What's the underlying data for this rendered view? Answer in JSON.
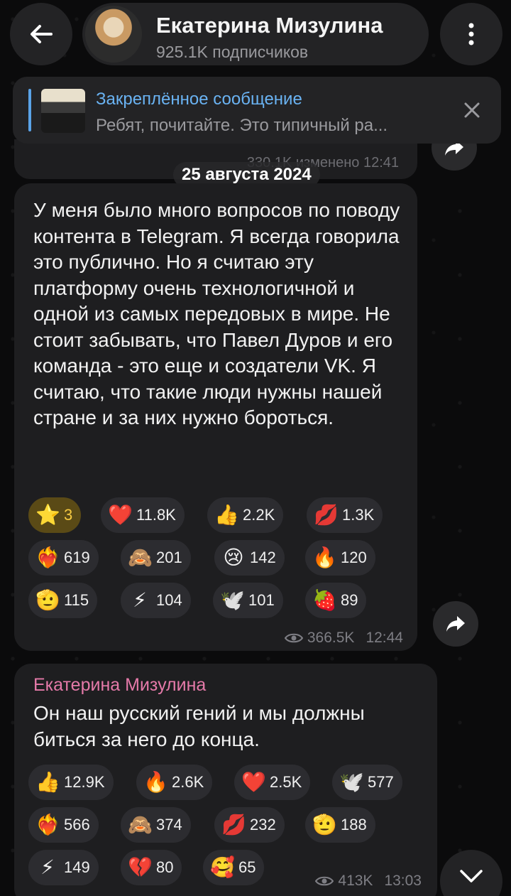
{
  "header": {
    "channel_name": "Екатерина Мизулина",
    "subscribers": "925.1K подписчиков"
  },
  "pinned": {
    "title": "Закреплённое сообщение",
    "text": "Ребят, почитайте. Это типичный ра..."
  },
  "previous_post": {
    "views": "330.1K",
    "edited_time": "изменено 12:41"
  },
  "date_separator": "25 августа 2024",
  "post1": {
    "text": "У меня было много вопросов по поводу контента в Telegram. Я всегда говорила это публично. Но я считаю эту платформу очень технологичной и одной из самых передовых в мире. Не стоит забывать, что Павел Дуров и его команда - это еще и создатели VK. Я считаю, что такие люди нужны нашей стране и за них нужно бороться.",
    "reactions": [
      {
        "emoji": "⭐",
        "count": "3"
      },
      {
        "emoji": "❤️",
        "count": "11.8K"
      },
      {
        "emoji": "👍",
        "count": "2.2K"
      },
      {
        "emoji": "💋",
        "count": "1.3K"
      },
      {
        "emoji": "❤️‍🔥",
        "count": "619"
      },
      {
        "emoji": "🙈",
        "count": "201"
      },
      {
        "emoji": "😢",
        "count": "142"
      },
      {
        "emoji": "🔥",
        "count": "120"
      },
      {
        "emoji": "🫡",
        "count": "115"
      },
      {
        "emoji": "⚡",
        "count": "104"
      },
      {
        "emoji": "🕊️",
        "count": "101"
      },
      {
        "emoji": "🍓",
        "count": "89"
      }
    ],
    "views": "366.5K",
    "time": "12:44"
  },
  "post2": {
    "sender": "Екатерина Мизулина",
    "text": "Он наш русский гений и мы должны биться за него до конца.",
    "reactions": [
      {
        "emoji": "👍",
        "count": "12.9K"
      },
      {
        "emoji": "🔥",
        "count": "2.6K"
      },
      {
        "emoji": "❤️",
        "count": "2.5K"
      },
      {
        "emoji": "🕊️",
        "count": "577"
      },
      {
        "emoji": "❤️‍🔥",
        "count": "566"
      },
      {
        "emoji": "🙈",
        "count": "374"
      },
      {
        "emoji": "💋",
        "count": "232"
      },
      {
        "emoji": "🫡",
        "count": "188"
      },
      {
        "emoji": "⚡",
        "count": "149"
      },
      {
        "emoji": "💔",
        "count": "80"
      },
      {
        "emoji": "🥰",
        "count": "65"
      }
    ],
    "views": "413K",
    "time": "13:03"
  },
  "colors": {
    "background": "#0b0b0c",
    "bubble": "#1e1e20",
    "accent_link": "#6ab3f3",
    "sender_name": "#e57aa9",
    "paid_star": "#f6c941"
  }
}
